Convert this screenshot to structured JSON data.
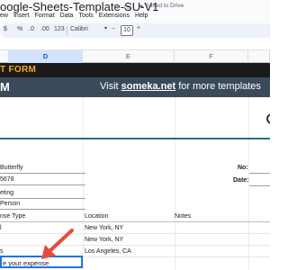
{
  "titlebar": {
    "doc_title": "oogle-Sheets-Template-SU-V1",
    "saved_status": "Saved to Drive",
    "menus": [
      "ew",
      "Insert",
      "Format",
      "Data",
      "Tools",
      "Extensions",
      "Help"
    ]
  },
  "toolbar": {
    "currency": "$",
    "percent": "%",
    "decrease_decimal": ".0",
    "increase_decimal": ".00",
    "number_format": "123",
    "font": "Calibri",
    "font_size": "10",
    "decrease_size": "−",
    "increase_size": "+"
  },
  "columns": {
    "d": "D",
    "e": "E",
    "f": "F"
  },
  "banner": {
    "top_text": "T FORM",
    "main_left": "M",
    "visit_prefix": "Visit ",
    "visit_link": "someka.net",
    "visit_suffix": " for more templates"
  },
  "info": {
    "name": "Butterfly",
    "phone": "5678",
    "department": "eting",
    "person": "Person",
    "no_label": "No:",
    "date_label": "Date:"
  },
  "table": {
    "headers": [
      "nse Type",
      "Location",
      "Notes"
    ],
    "rows": [
      {
        "type": "l",
        "location": "New York, NY",
        "notes": ""
      },
      {
        "type": "",
        "location": "New York, NY",
        "notes": ""
      },
      {
        "type": "s",
        "location": "Los Angeles, CA",
        "notes": ""
      }
    ],
    "active_cell_text": "e your expense"
  },
  "colors": {
    "banner_dark": "#1a1a1a",
    "banner_accent": "#f5a623",
    "banner_main": "#3b4a5a",
    "teal": "#2c6e7f",
    "selection_blue": "#1a73e8",
    "arrow_red": "#e84a3c"
  }
}
